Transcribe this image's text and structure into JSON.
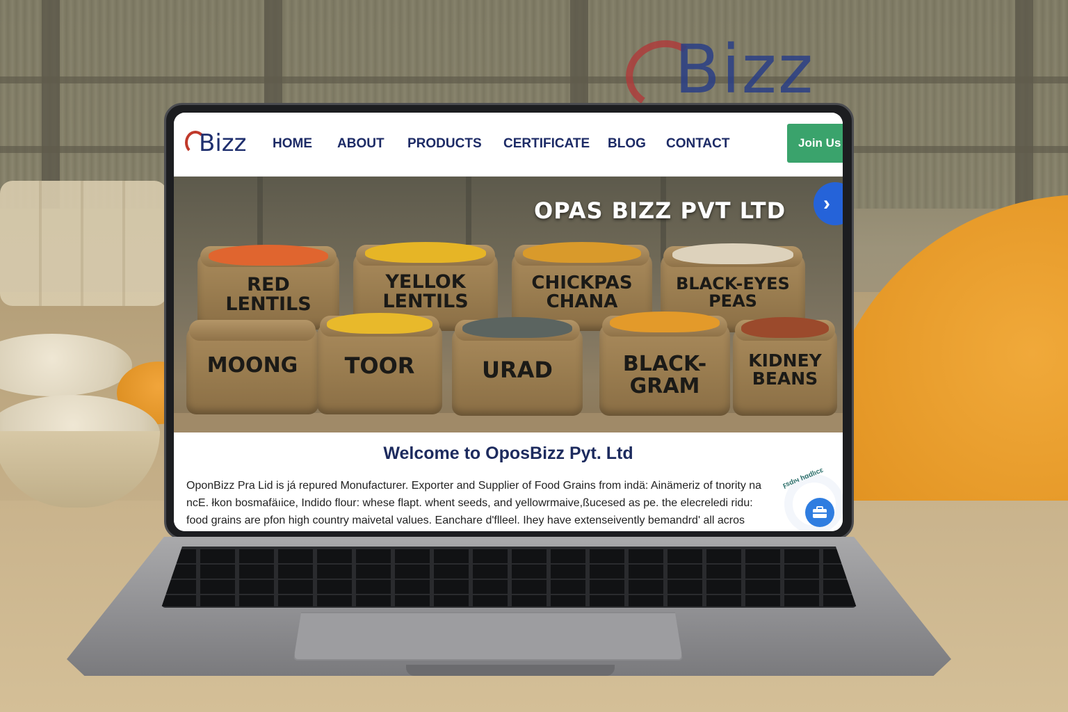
{
  "background": {
    "logo_text": "Bizz"
  },
  "site": {
    "logo_text": "Bizz",
    "nav": [
      {
        "label": "HOME"
      },
      {
        "label": "ABOUT"
      },
      {
        "label": "PRODUCTS"
      },
      {
        "label": "CERTIFICATE"
      },
      {
        "label": "BLOG"
      },
      {
        "label": "CONTACT"
      }
    ],
    "join_label": "Join Us",
    "hero_title": "OPAS BIZZ PVT LTD",
    "next_icon": "chevron-right-icon",
    "sacks_back": [
      {
        "line1": "RED",
        "line2": "LENTILS",
        "grain_color": "#e0652f"
      },
      {
        "line1": "YELLOK",
        "line2": "LENTILS",
        "grain_color": "#e6b526"
      },
      {
        "line1": "CHICKPAS",
        "line2": "CHANA",
        "grain_color": "#d99a2b"
      },
      {
        "line1": "BLACK-EYES",
        "line2": "PEAS",
        "grain_color": "#ddd2bc"
      }
    ],
    "sacks_front": [
      {
        "line1": "MOONG",
        "line2": "",
        "grain_color": "#c9b26e"
      },
      {
        "line1": "TOOR",
        "line2": "",
        "grain_color": "#e8b92b"
      },
      {
        "line1": "URAD",
        "line2": "",
        "grain_color": "#5b6460"
      },
      {
        "line1": "BLACK-",
        "line2": "GRAM",
        "grain_color": "#e39a2a"
      },
      {
        "line1": "KIDNEY",
        "line2": "BEANS",
        "grain_color": "#9b4a2c"
      }
    ],
    "welcome_title": "Welcome to OposBizz Pyt. Ltd",
    "paragraph": [
      "OponBizz Pra Lid is já repured Monufacturer. Exporter and Supplier of Food Grains from indä: Ainämeriz of tnority na",
      "ncE. łkon bosmafäıice, Indido flour: whese flapt. whent seeds, and yellowrmaive,ßucesed as pe. the elecreledi ridu:",
      "food grains are pfon high country maivetal values. Eanchare d'flleel. Ihey have extenseivently bemandrd' all acros"
    ],
    "chat_badge_text": "ϝsdıч hɑdlιcɛ",
    "chat_icon": "chat-briefcase-icon"
  },
  "colors": {
    "nav_text": "#1d2b66",
    "join_button": "#3aa36c",
    "next_button": "#2563d9",
    "chat_button": "#2f7de0",
    "logo_blue": "#1f2f6e",
    "logo_red": "#c0392b"
  }
}
